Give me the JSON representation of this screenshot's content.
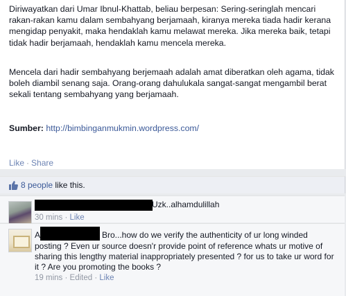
{
  "post": {
    "paragraph1": "Diriwayatkan dari Umar Ibnul-Khattab, beliau berpesan: Sering-seringlah mencari rakan-rakan kamu dalam sembahyang berjamaah, kiranya mereka tiada hadir kerana mengidap penyakit, maka hendaklah kamu melawat mereka. Jika mereka baik, tetapi tidak hadir berjamaah, hendaklah kamu mencela mereka.",
    "paragraph2": "Mencela dari hadir sembahyang berjemaah adalah amat diberatkan oleh agama, tidak boleh diambil senang saja. Orang-orang dahulukala sangat-sangat mengambil berat sekali tentang sembahyang yang berjamaah.",
    "source_label": "Sumber:",
    "source_url": "http://bimbinganmukmin.wordpress.com/",
    "like_link": "Like",
    "separator": "·",
    "share_link": "Share"
  },
  "likes": {
    "count_link": "8 people",
    "suffix": " like this."
  },
  "comments": [
    {
      "text": "Uzk..alhamdulillah",
      "time": "30 mins",
      "separator": "·",
      "like": "Like"
    },
    {
      "lead": "A",
      "rest": "Bro...how do we verify the authenticity of ur long winded",
      "body": "posting ? Even ur source doesn'r provide point of reference whats ur motive of sharing this lengthy material inappropriately presented ? for us to take ur word for it ? Are you promoting the books ?",
      "time": "19 mins",
      "separator1": "·",
      "edited": "Edited",
      "separator2": "·",
      "like": "Like"
    }
  ],
  "colors": {
    "link": "#3b5998",
    "meta": "#9197a3",
    "background": "#e9ebee"
  }
}
